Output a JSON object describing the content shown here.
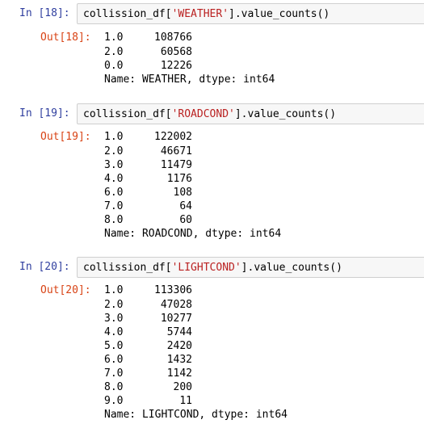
{
  "cells": [
    {
      "in_prompt": "In [18]:",
      "code_prefix": "collission_df[",
      "code_string": "'WEATHER'",
      "code_suffix": "].value_counts()",
      "out_prompt": "Out[18]:",
      "rows": [
        {
          "index": "1.0",
          "count": "108766"
        },
        {
          "index": "2.0",
          "count": "60568"
        },
        {
          "index": "0.0",
          "count": "12226"
        }
      ],
      "footer": "Name: WEATHER, dtype: int64"
    },
    {
      "in_prompt": "In [19]:",
      "code_prefix": "collission_df[",
      "code_string": "'ROADCOND'",
      "code_suffix": "].value_counts()",
      "out_prompt": "Out[19]:",
      "rows": [
        {
          "index": "1.0",
          "count": "122002"
        },
        {
          "index": "2.0",
          "count": "46671"
        },
        {
          "index": "3.0",
          "count": "11479"
        },
        {
          "index": "4.0",
          "count": "1176"
        },
        {
          "index": "6.0",
          "count": "108"
        },
        {
          "index": "7.0",
          "count": "64"
        },
        {
          "index": "8.0",
          "count": "60"
        }
      ],
      "footer": "Name: ROADCOND, dtype: int64"
    },
    {
      "in_prompt": "In [20]:",
      "code_prefix": "collission_df[",
      "code_string": "'LIGHTCOND'",
      "code_suffix": "].value_counts()",
      "out_prompt": "Out[20]:",
      "rows": [
        {
          "index": "1.0",
          "count": "113306"
        },
        {
          "index": "2.0",
          "count": "47028"
        },
        {
          "index": "3.0",
          "count": "10277"
        },
        {
          "index": "4.0",
          "count": "5744"
        },
        {
          "index": "5.0",
          "count": "2420"
        },
        {
          "index": "6.0",
          "count": "1432"
        },
        {
          "index": "7.0",
          "count": "1142"
        },
        {
          "index": "8.0",
          "count": "200"
        },
        {
          "index": "9.0",
          "count": "11"
        }
      ],
      "footer": "Name: LIGHTCOND, dtype: int64"
    }
  ],
  "colors": {
    "in_prompt": "#303f9f",
    "out_prompt": "#d84315",
    "string_literal": "#ba2121",
    "input_bg": "#f7f7f7",
    "input_border": "#cfcfcf"
  }
}
